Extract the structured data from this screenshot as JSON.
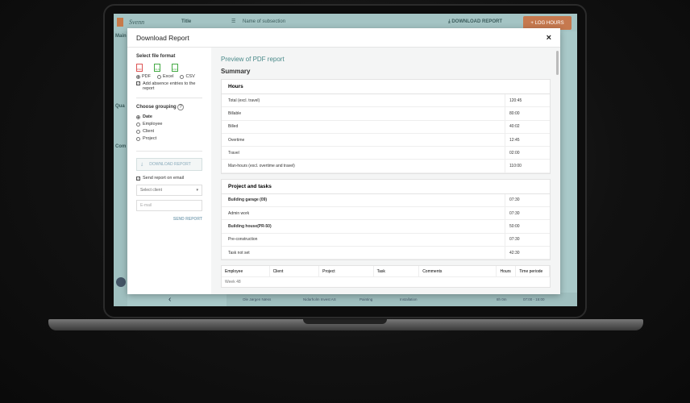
{
  "app": {
    "logo": "Svenn",
    "title": "Title",
    "subsection": "Name of subsection",
    "download_report": "DOWNLOAD REPORT",
    "log_hours": "+ LOG HOURS",
    "side_labels": [
      "Main",
      "Qua",
      "Com"
    ]
  },
  "modal": {
    "title": "Download Report",
    "close": "×",
    "file_format": {
      "label": "Select file format",
      "options": [
        {
          "label": "PDF",
          "icon": "PDF",
          "selected": true
        },
        {
          "label": "Excel",
          "icon": "XLS",
          "selected": false
        },
        {
          "label": "CSV",
          "icon": "CSV",
          "selected": false
        }
      ],
      "absence": "Add absence entries to the report"
    },
    "grouping": {
      "label": "Choose grouping",
      "help": "?",
      "options": [
        {
          "label": "Date",
          "selected": true
        },
        {
          "label": "Employee",
          "selected": false
        },
        {
          "label": "Client",
          "selected": false
        },
        {
          "label": "Project",
          "selected": false
        }
      ]
    },
    "download_button": "DOWNLOAD REPORT",
    "send_email": "Send report on email",
    "select_client": "Select client",
    "email_placeholder": "E-mail",
    "send_button": "SEND REPORT"
  },
  "preview": {
    "title": "Preview of PDF report",
    "summary": "Summary",
    "hours": {
      "title": "Hours",
      "rows": [
        {
          "k": "Total (excl. travel)",
          "v": "120:45"
        },
        {
          "k": "Billable",
          "v": "80:00"
        },
        {
          "k": "Billed",
          "v": "40:02"
        },
        {
          "k": "Overtime",
          "v": "12:45"
        },
        {
          "k": "Travel",
          "v": "02:00"
        },
        {
          "k": "Man-hours (excl. overtime and travel)",
          "v": "110:00"
        }
      ]
    },
    "projects": {
      "title": "Project and tasks",
      "rows": [
        {
          "k": "Building garage (09)",
          "v": "07:30",
          "bold": true
        },
        {
          "k": "Admin work",
          "v": "07:30"
        },
        {
          "k": "Building house(PR-50)",
          "v": "50:00",
          "bold": true
        },
        {
          "k": "Pre-construction",
          "v": "07:30"
        },
        {
          "k": "Task not set",
          "v": "42:30"
        }
      ]
    },
    "table": {
      "headers": [
        "Employee",
        "Client",
        "Project",
        "Task",
        "Comments",
        "Hours",
        "Time periode"
      ],
      "week": "Week 48"
    }
  },
  "background_row": {
    "name": "Ole Jørgen Næss",
    "client": "Nidarholm Invest AS",
    "project": "Painting",
    "task": "Installation",
    "hours": "8h 0m",
    "period": "07:00 - 15:00"
  },
  "collapse": "‹"
}
